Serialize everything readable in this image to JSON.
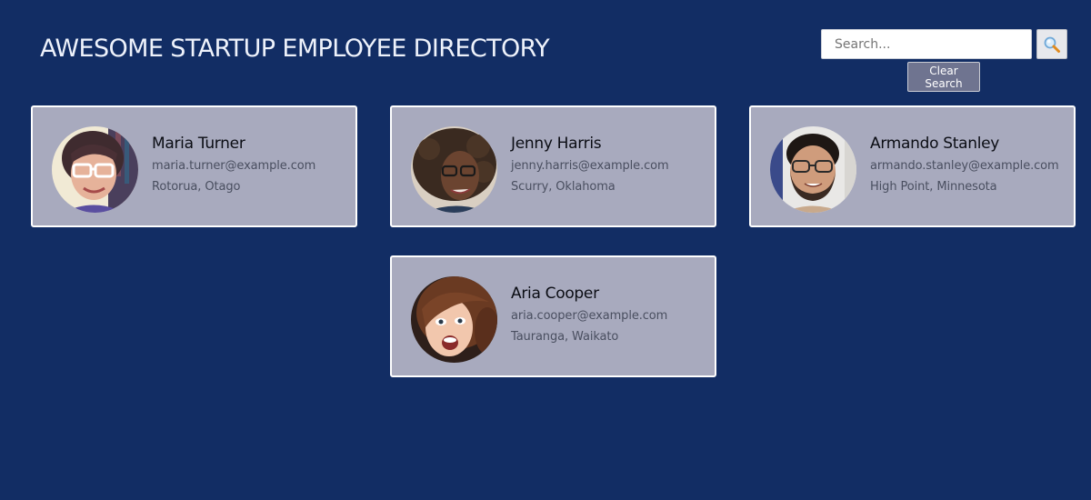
{
  "header": {
    "title": "AWESOME STARTUP EMPLOYEE DIRECTORY"
  },
  "search": {
    "placeholder": "Search...",
    "value": "",
    "search_icon": "magnifying-glass-icon",
    "clear_label": "Clear Search"
  },
  "colors": {
    "page_background": "#122d64",
    "card_background": "#a8aabe",
    "card_border": "#ffffff",
    "clear_button": "#6f7490"
  },
  "employees": [
    {
      "name": "Maria Turner",
      "email": "maria.turner@example.com",
      "location": "Rotorua, Otago"
    },
    {
      "name": "Jenny Harris",
      "email": "jenny.harris@example.com",
      "location": "Scurry, Oklahoma"
    },
    {
      "name": "Armando Stanley",
      "email": "armando.stanley@example.com",
      "location": "High Point, Minnesota"
    },
    {
      "name": "Aria Cooper",
      "email": "aria.cooper@example.com",
      "location": "Tauranga, Waikato"
    }
  ]
}
